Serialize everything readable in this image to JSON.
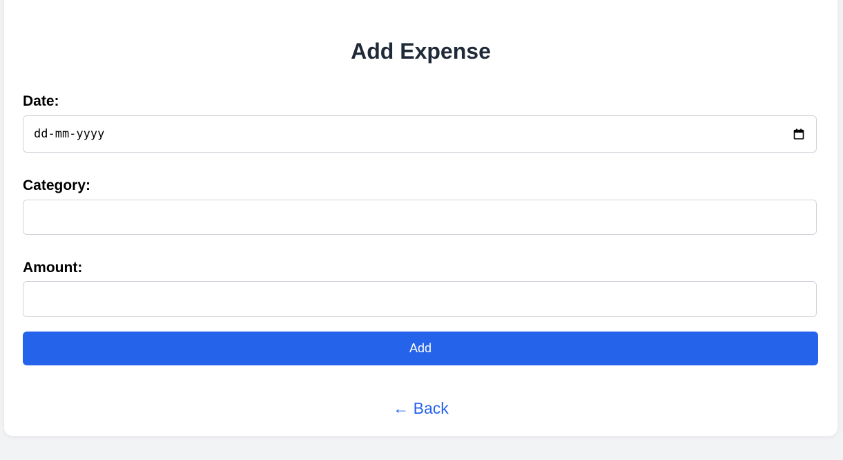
{
  "page": {
    "title": "Add Expense"
  },
  "form": {
    "date": {
      "label": "Date:",
      "placeholder": "dd-mm-yyyy",
      "value": ""
    },
    "category": {
      "label": "Category:",
      "value": ""
    },
    "amount": {
      "label": "Amount:",
      "value": ""
    },
    "submit_label": "Add"
  },
  "nav": {
    "back_label": "← Back"
  },
  "colors": {
    "accent": "#2563eb",
    "title": "#1f2937",
    "background": "#f2f3f5"
  },
  "icons": {
    "date_picker": "calendar-icon"
  }
}
